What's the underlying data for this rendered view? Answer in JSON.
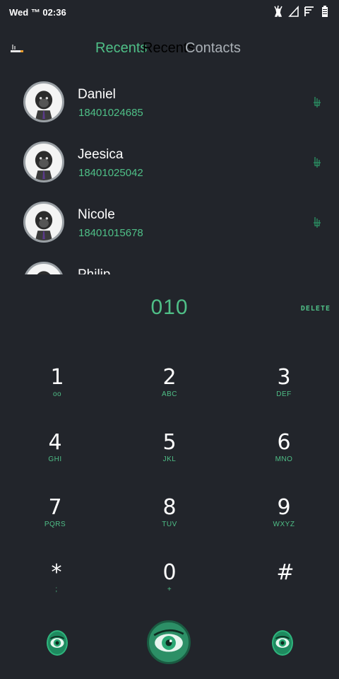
{
  "status_bar": {
    "time": "Wed ™ 02:36",
    "icons": [
      "deer-icon",
      "signal-icon",
      "wifi-icon",
      "battery-icon"
    ]
  },
  "tabs": {
    "menu_icon": "cigarette-icon",
    "recents_label": "Recents",
    "recents_overlay_label": "Recents",
    "contacts_label": "Contacts"
  },
  "recents": [
    {
      "name": "Daniel",
      "phone": "18401024685",
      "avatar_icon": "gorilla-avatar-icon",
      "action_icon": "call-icon"
    },
    {
      "name": "Jeesica",
      "phone": "18401025042",
      "avatar_icon": "gorilla-avatar-icon",
      "action_icon": "call-icon"
    },
    {
      "name": "Nicole",
      "phone": "18401015678",
      "avatar_icon": "gorilla-avatar-icon",
      "action_icon": "call-icon"
    },
    {
      "name": "Philip",
      "phone": "",
      "avatar_icon": "gorilla-avatar-icon",
      "action_icon": "call-icon"
    }
  ],
  "dialer": {
    "entered_number": "010",
    "delete_label": "DELETE"
  },
  "keypad": [
    {
      "digit": "1",
      "letters": "oo"
    },
    {
      "digit": "2",
      "letters": "ABC"
    },
    {
      "digit": "3",
      "letters": "DEF"
    },
    {
      "digit": "4",
      "letters": "GHI"
    },
    {
      "digit": "5",
      "letters": "JKL"
    },
    {
      "digit": "6",
      "letters": "MNO"
    },
    {
      "digit": "7",
      "letters": "PQRS"
    },
    {
      "digit": "8",
      "letters": "TUV"
    },
    {
      "digit": "9",
      "letters": "WXYZ"
    },
    {
      "digit": "*",
      "letters": ";"
    },
    {
      "digit": "0",
      "letters": "+"
    },
    {
      "digit": "#",
      "letters": ""
    }
  ],
  "bottom_bar": {
    "left_icon": "eye-icon",
    "call_icon": "eye-call-icon",
    "right_icon": "eye-icon"
  },
  "colors": {
    "background": "#22252b",
    "accent": "#4fbf87",
    "text": "#ffffff",
    "muted": "#aab0b6"
  }
}
